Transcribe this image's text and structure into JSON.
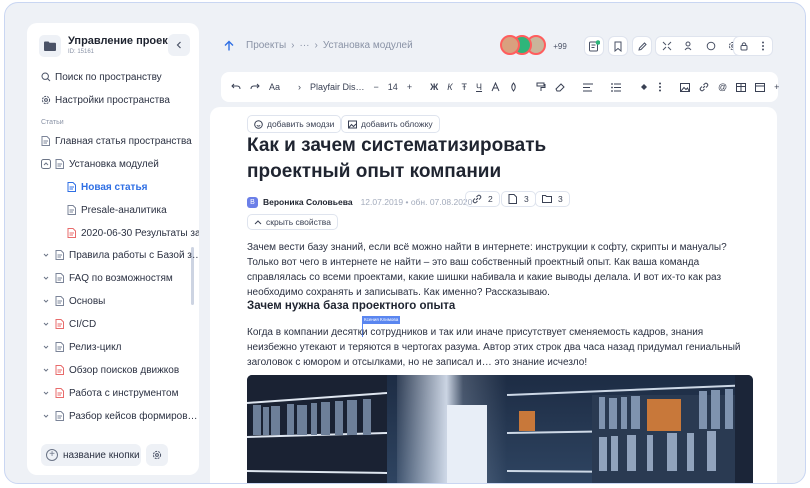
{
  "space": {
    "title": "Управление проек…",
    "subtitle": "ID: 15161"
  },
  "sidebar": {
    "nav": [
      {
        "label": "Поиск по пространству",
        "icon": "search-icon"
      },
      {
        "label": "Настройки пространства",
        "icon": "settings-icon"
      }
    ],
    "section_label": "Статьи",
    "tree": [
      {
        "label": "Главная статья пространства",
        "depth": 0,
        "chevron": false
      },
      {
        "label": "Установка модулей",
        "depth": 0,
        "chevron": "up"
      },
      {
        "label": "Новая статья",
        "depth": 1,
        "chevron": false,
        "active": true
      },
      {
        "label": "Presale-аналитика",
        "depth": 1,
        "chevron": false
      },
      {
        "label": "2020-06-30 Результаты за",
        "depth": 1,
        "chevron": false,
        "red": true
      },
      {
        "label": "Правила работы с Базой з…",
        "depth": 0,
        "chevron": "down"
      },
      {
        "label": "FAQ по возможностям",
        "depth": 0,
        "chevron": "down"
      },
      {
        "label": "Основы",
        "depth": 0,
        "chevron": "down"
      },
      {
        "label": "CI/CD",
        "depth": 0,
        "chevron": "down",
        "red": true
      },
      {
        "label": "Релиз-цикл",
        "depth": 0,
        "chevron": "down"
      },
      {
        "label": "Обзор поисков движков",
        "depth": 0,
        "chevron": "down",
        "red": true
      },
      {
        "label": "Работа с инструментом",
        "depth": 0,
        "chevron": "down",
        "red": true
      },
      {
        "label": "Разбор кейсов формиров…",
        "depth": 0,
        "chevron": "down"
      }
    ],
    "add_button_label": "название кнопки"
  },
  "topbar": {
    "breadcrumbs": [
      "Проекты",
      "›",
      "···",
      "›",
      "Установка модулей"
    ],
    "avatar_count": "+99"
  },
  "editor_toolbar": {
    "text_style": "Aa",
    "font_name": "Playfair Dis…",
    "font_size": "14",
    "minus": "−",
    "plus_sign": "+",
    "bold": "Ж",
    "italic": "К",
    "strike": "Ŧ",
    "underline": "Ч"
  },
  "article": {
    "add_emoji": "добавить эмодзи",
    "add_cover": "добавить обложку",
    "title": "Как и зачем систематизировать проектный опыт компании",
    "author_initial": "В",
    "author": "Вероника Соловьева",
    "dates": "12.07.2019 • обн. 07.08.2020",
    "stats": {
      "links": "2",
      "pages": "3",
      "folders": "3"
    },
    "hide_props": "скрыть свойства",
    "paragraph1": "Зачем вести базу знаний, если всё можно найти в интернете: инструкции к софту, скрипты и мануалы? Только вот чего в интернете не найти – это ваш собственный проектный опыт. Как ваша команда справлялась со всеми проектами, какие шишки набивала и какие выводы делала. И вот их-то как раз необходимо сохранять и записывать. Как именно? Рассказываю.",
    "subheading": "Зачем нужна база проектного опыта",
    "cursor_user": "Ксения Климова",
    "paragraph2": "Когда в компании десятки сотрудников и так или иначе присутствует сменяемость кадров, знания неизбежно утекают и теряются в чертогах разума. Автор этих строк два часа назад придумал гениальный заголовок с юмором и отсылками, но не записал и… это знание исчезло!"
  },
  "colors": {
    "accent": "#2f6fe4",
    "frame_border": "#c9d6f2",
    "background": "#eef1f6",
    "doc_red": "#e86b6b"
  }
}
